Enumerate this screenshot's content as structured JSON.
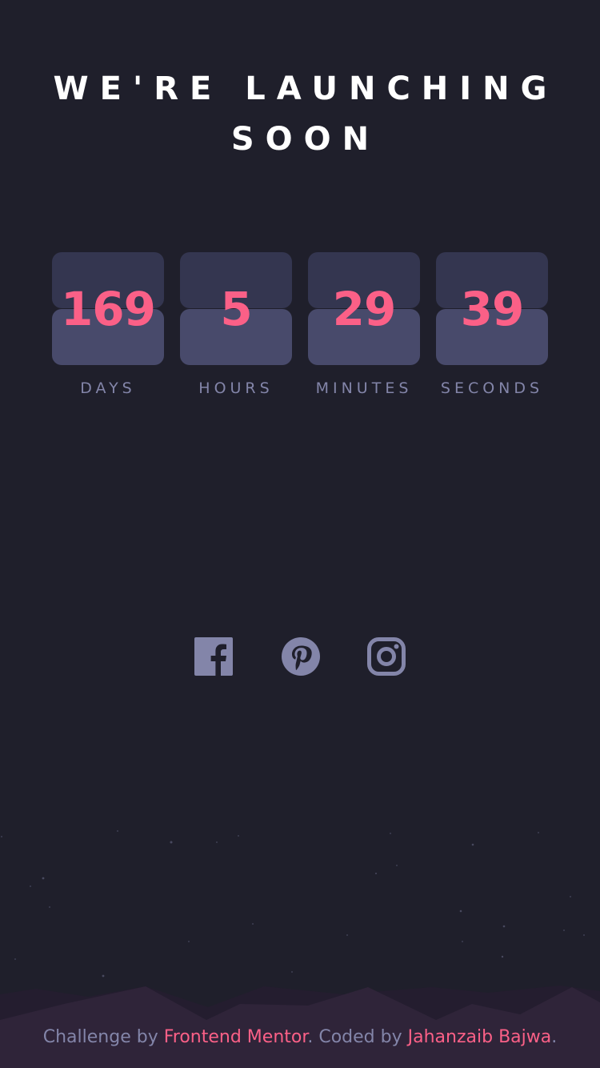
{
  "title": {
    "line1": "WE'RE LAUNCHING",
    "line2": "SOON"
  },
  "countdown": [
    {
      "value": "169",
      "label": "DAYS"
    },
    {
      "value": "5",
      "label": "HOURS"
    },
    {
      "value": "29",
      "label": "MINUTES"
    },
    {
      "value": "39",
      "label": "SECONDS"
    }
  ],
  "social": {
    "facebook": "facebook-icon",
    "pinterest": "pinterest-icon",
    "instagram": "instagram-icon"
  },
  "footer": {
    "challenge_text": "Challenge by",
    "challenge_link": "Frontend Mentor",
    "coded_text": ". Coded by",
    "author_link": "Jahanzaib Bajwa",
    "end": "."
  },
  "colors": {
    "background": "#1f1f2b",
    "accent": "#fb6087",
    "muted": "#8385a9",
    "card_top": "#343650",
    "card_bottom": "#484a6b",
    "hills": "#2f2439"
  }
}
